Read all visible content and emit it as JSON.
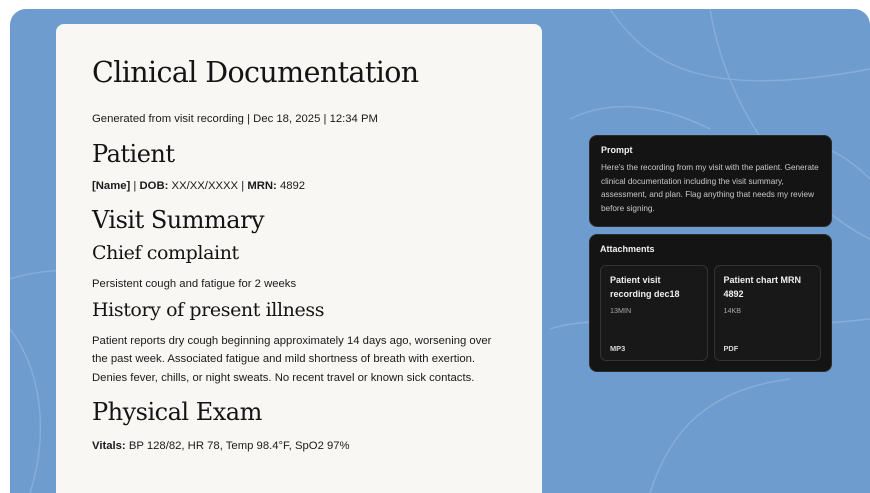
{
  "colors": {
    "background": "#6f9ccf",
    "document": "#f8f7f3",
    "panel": "#141414"
  },
  "document": {
    "title": "Clinical Documentation",
    "subtitle": "Generated from visit recording | Dec 18, 2025 | 12:34 PM",
    "patient_heading": "Patient",
    "patient_line": {
      "name": "[Name]",
      "sep1": " | ",
      "dob_label": "DOB:",
      "dob_value": " XX/XX/XXXX",
      "sep2": " | ",
      "mrn_label": "MRN:",
      "mrn_value": " 4892"
    },
    "visit_summary_heading": "Visit Summary",
    "chief_complaint_heading": "Chief complaint",
    "chief_complaint_text": "Persistent cough and fatigue for 2 weeks",
    "hpi_heading": "History of present illness",
    "hpi_text": "Patient reports dry cough beginning approximately 14 days ago, worsening over the past week. Associated fatigue and mild shortness of breath with exertion. Denies fever, chills, or night sweats. No recent travel or known sick contacts.",
    "physical_exam_heading": "Physical Exam",
    "vitals_label": "Vitals:",
    "vitals_value": " BP 128/82, HR 78, Temp 98.4°F, SpO2 97%"
  },
  "prompt": {
    "title": "Prompt",
    "text": "Here's the recording from my visit with the patient. Generate clinical documentation including the visit summary, assessment, and plan. Flag anything that needs my review before signing."
  },
  "attachments": {
    "title": "Attachments",
    "items": [
      {
        "name": "Patient visit recording dec18",
        "size": "13MIN",
        "type": "MP3"
      },
      {
        "name": "Patient chart MRN 4892",
        "size": "14KB",
        "type": "PDF"
      }
    ]
  }
}
